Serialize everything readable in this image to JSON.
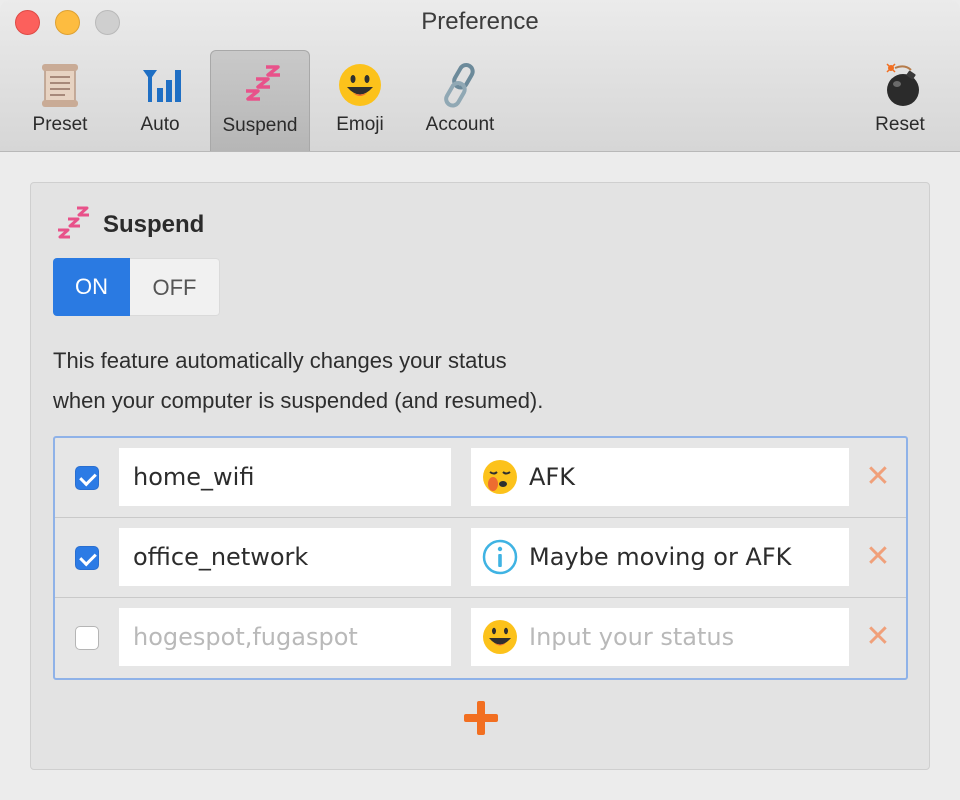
{
  "window": {
    "title": "Preference"
  },
  "toolbar": {
    "items": [
      {
        "label": "Preset",
        "icon": "scroll-icon"
      },
      {
        "label": "Auto",
        "icon": "signal-antenna-icon"
      },
      {
        "label": "Suspend",
        "icon": "zzz-icon",
        "active": true
      },
      {
        "label": "Emoji",
        "icon": "smiley-icon"
      },
      {
        "label": "Account",
        "icon": "link-chain-icon"
      }
    ],
    "reset": {
      "label": "Reset",
      "icon": "bomb-icon"
    }
  },
  "section": {
    "title": "Suspend",
    "icon": "zzz-icon",
    "toggle": {
      "on_label": "ON",
      "off_label": "OFF",
      "selected": "ON"
    },
    "description_line1": "This feature automatically changes your status",
    "description_line2": "when your computer is suspended (and resumed)."
  },
  "rules": [
    {
      "checked": true,
      "network": "home_wifi",
      "network_placeholder": "",
      "status": "AFK",
      "status_icon": "sleepy-face-icon",
      "status_placeholder": ""
    },
    {
      "checked": true,
      "network": "office_network",
      "network_placeholder": "",
      "status": "Maybe moving or AFK",
      "status_icon": "info-icon",
      "status_placeholder": ""
    },
    {
      "checked": false,
      "network": "",
      "network_placeholder": "hogespot,fugaspot",
      "status": "",
      "status_icon": "smiley-icon",
      "status_placeholder": "Input your status"
    }
  ],
  "colors": {
    "accent": "#2a7ae2",
    "add": "#f26f21",
    "delete": "#f0a07a",
    "zzz": "#e8528a"
  }
}
